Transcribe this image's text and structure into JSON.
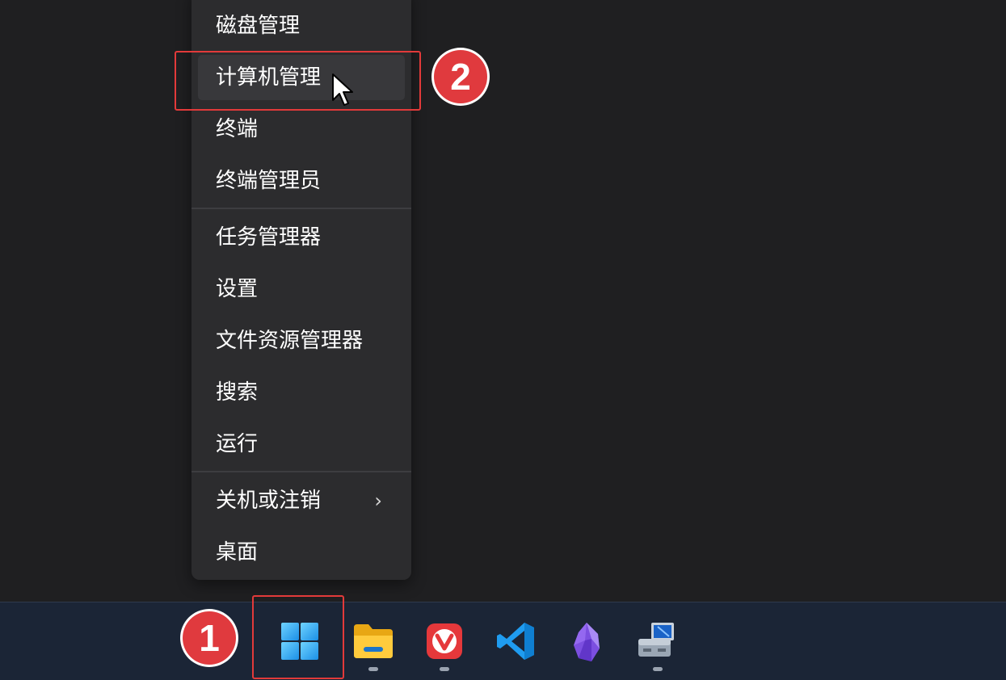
{
  "context_menu": {
    "items": [
      {
        "label": "磁盘管理"
      },
      {
        "label": "计算机管理"
      },
      {
        "label": "终端"
      },
      {
        "label": "终端管理员"
      },
      {
        "label": "任务管理器"
      },
      {
        "label": "设置"
      },
      {
        "label": "文件资源管理器"
      },
      {
        "label": "搜索"
      },
      {
        "label": "运行"
      },
      {
        "label": "关机或注销",
        "submenu_icon": "chevron-right-icon"
      },
      {
        "label": "桌面"
      }
    ],
    "highlighted_item": "计算机管理",
    "submenu_chevron": "›"
  },
  "annotations": {
    "badge_1": "1",
    "badge_2": "2",
    "highlight_color": "#e23a3a"
  },
  "taskbar": {
    "icons": [
      {
        "name": "windows-start-icon",
        "running": false
      },
      {
        "name": "file-explorer-icon",
        "running": true
      },
      {
        "name": "vivaldi-browser-icon",
        "running": true
      },
      {
        "name": "vscode-icon",
        "running": false
      },
      {
        "name": "obsidian-icon",
        "running": false
      },
      {
        "name": "network-computer-icon",
        "running": true
      }
    ]
  }
}
